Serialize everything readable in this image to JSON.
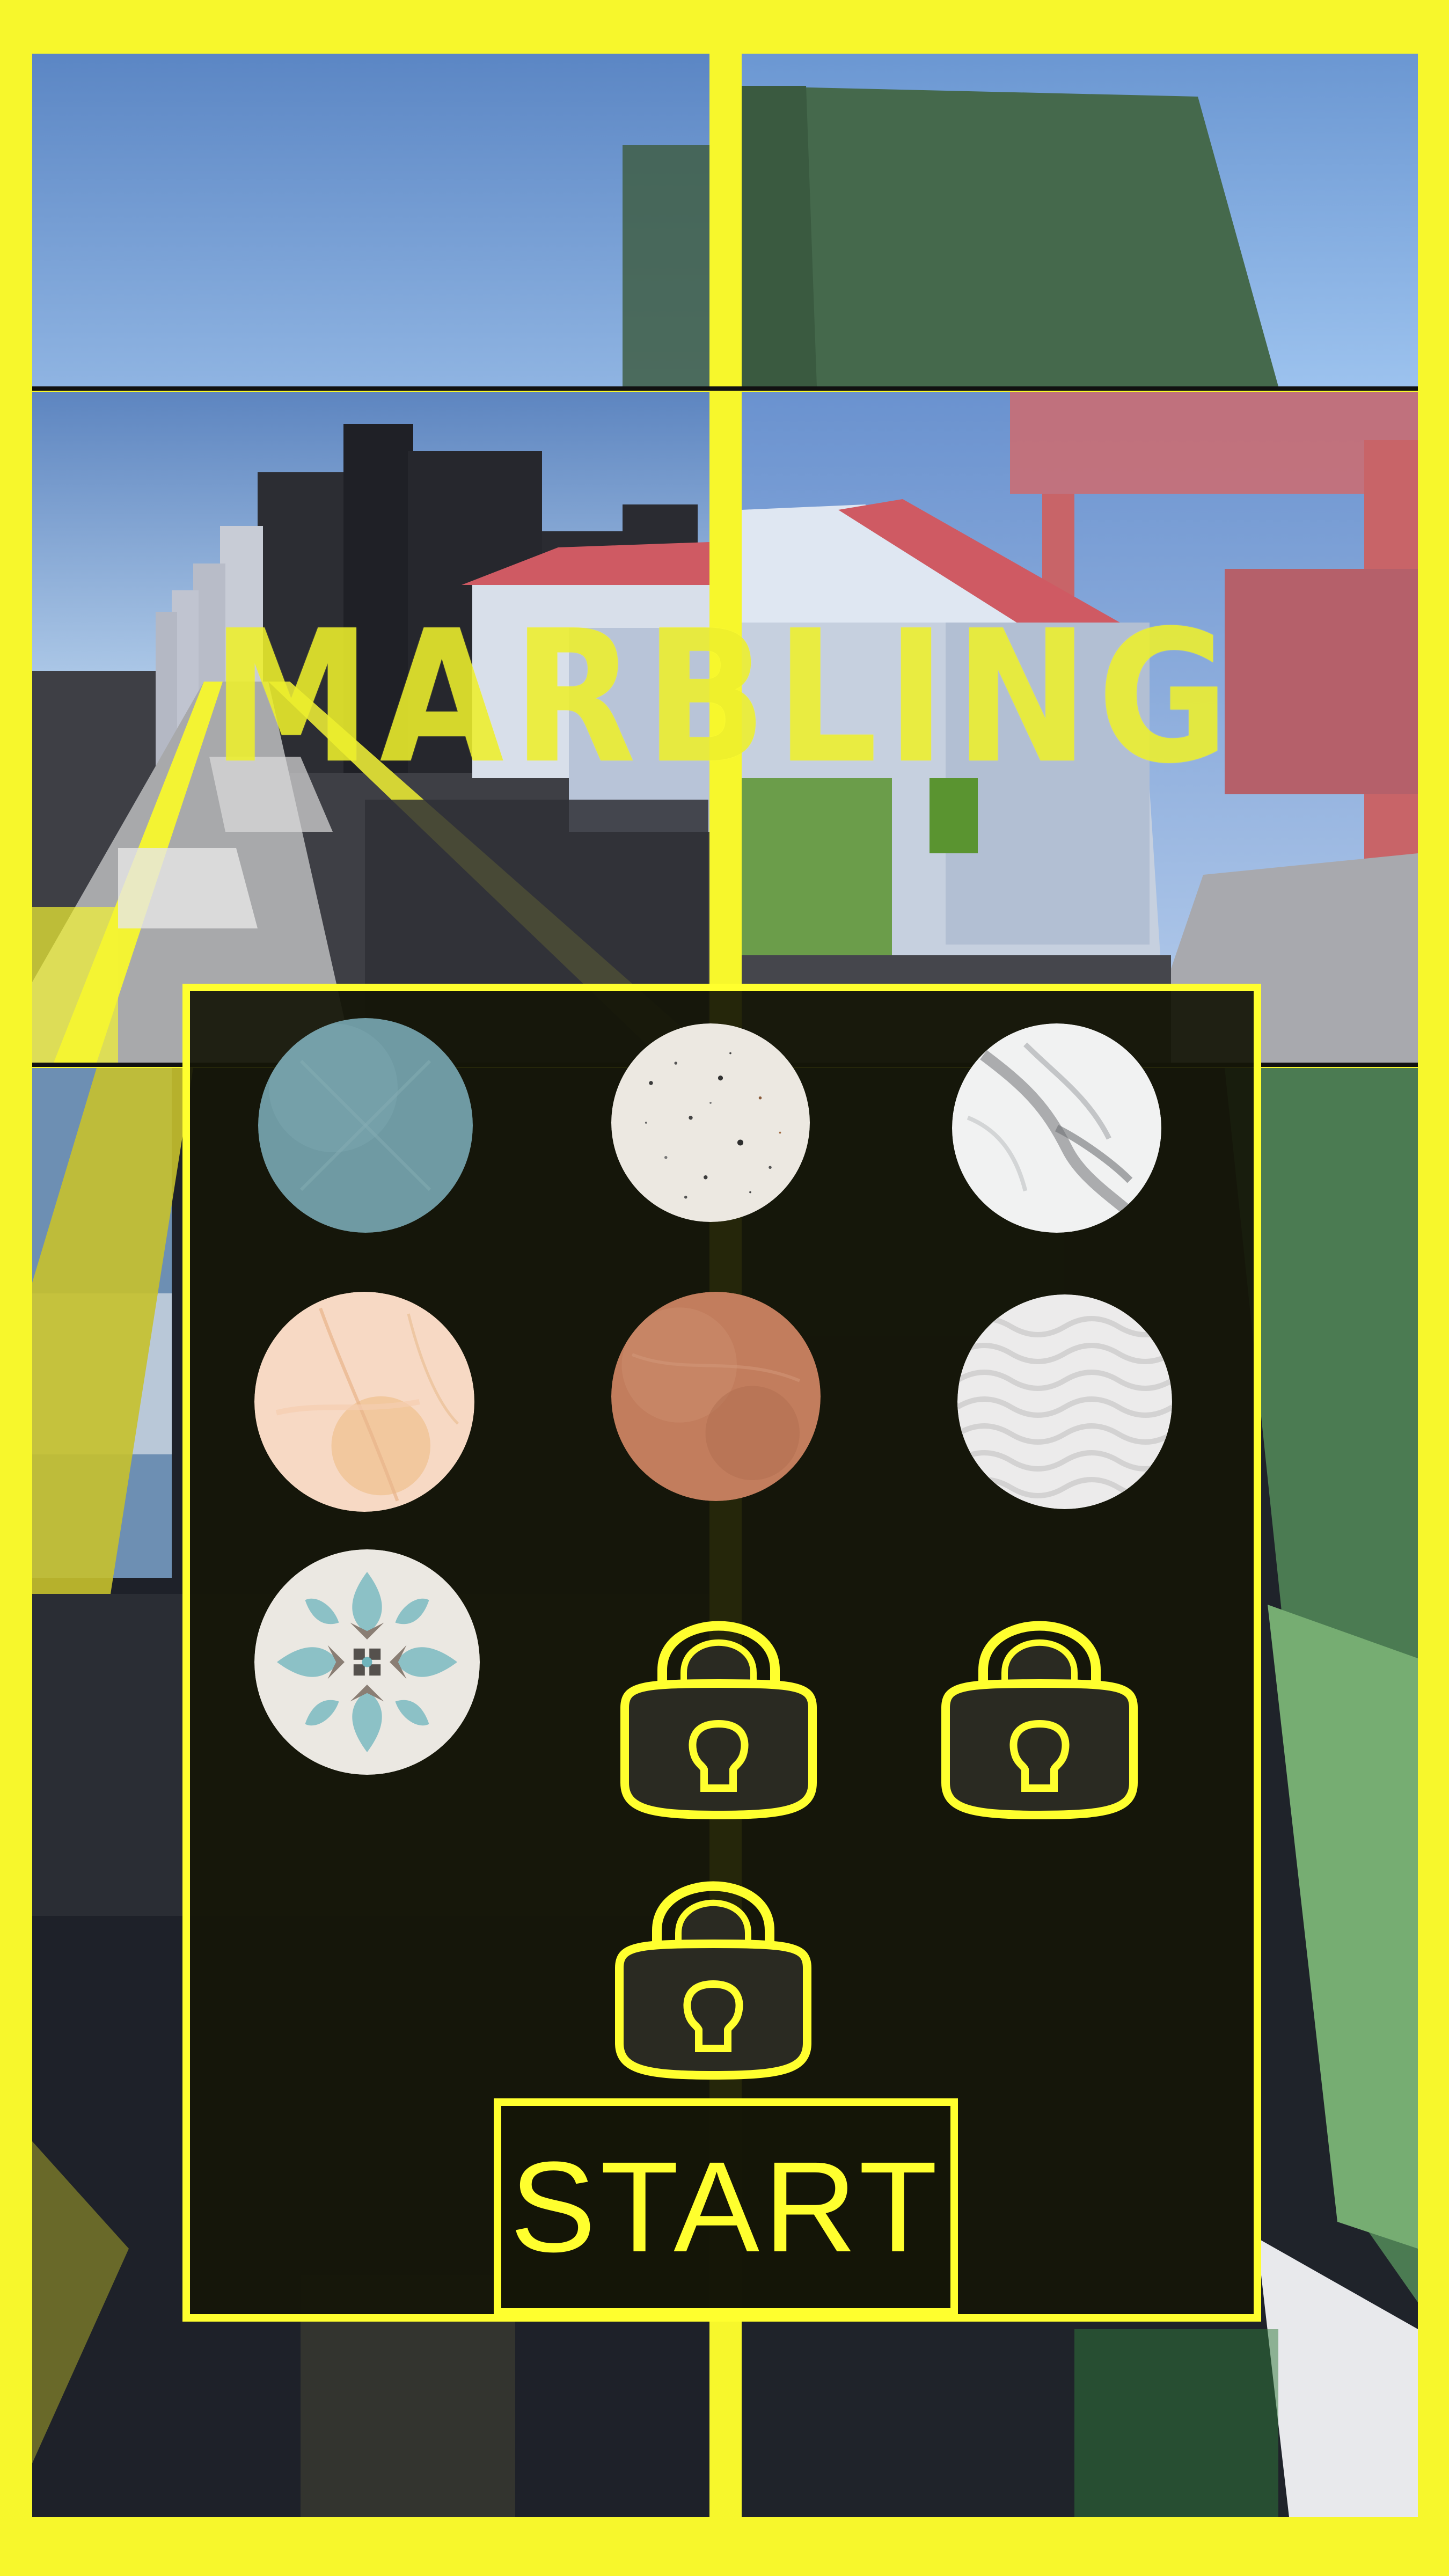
{
  "game": {
    "title": "MARBLING",
    "start_label": "START"
  },
  "colors": {
    "accent_yellow": "#ffff2e",
    "panel_dark": "#14160a"
  },
  "marbles": [
    {
      "id": "teal-stone",
      "unlocked": true,
      "icon": "teal-marble"
    },
    {
      "id": "speckled-white",
      "unlocked": true,
      "icon": "speckled-marble"
    },
    {
      "id": "white-grey-veined",
      "unlocked": true,
      "icon": "veined-marble"
    },
    {
      "id": "peach",
      "unlocked": true,
      "icon": "peach-marble"
    },
    {
      "id": "terracotta",
      "unlocked": true,
      "icon": "terracotta-marble"
    },
    {
      "id": "white-waves",
      "unlocked": true,
      "icon": "wave-marble"
    },
    {
      "id": "floral-tile",
      "unlocked": true,
      "icon": "tile-marble"
    },
    {
      "id": "locked-1",
      "unlocked": false,
      "icon": "lock-icon"
    },
    {
      "id": "locked-2",
      "unlocked": false,
      "icon": "lock-icon"
    },
    {
      "id": "locked-3",
      "unlocked": false,
      "icon": "lock-icon"
    }
  ]
}
